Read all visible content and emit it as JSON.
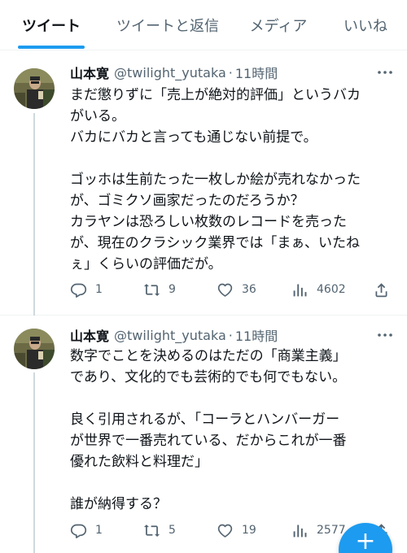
{
  "tabs": [
    {
      "label": "ツイート",
      "active": true
    },
    {
      "label": "ツイートと返信",
      "active": false
    },
    {
      "label": "メディア",
      "active": false
    },
    {
      "label": "いいね",
      "active": false
    }
  ],
  "colors": {
    "accent": "#1d9bf0",
    "text": "#0f1419",
    "secondary": "#536471",
    "divider": "#eff3f4"
  },
  "tweets": [
    {
      "name": "山本寛",
      "handle": "@twilight_yutaka",
      "dot": "·",
      "time": "11時間",
      "lines": [
        "まだ懲りずに「売上が絶対的評価」というバカ",
        "がいる。",
        "バカにバカと言っても通じない前提で。",
        "",
        "ゴッホは生前たった一枚しか絵が売れなかった",
        "が、ゴミクソ画家だったのだろうか？",
        "カラヤンは恐ろしい枚数のレコードを売った",
        "が、現在のクラシック業界では「まぁ、いたね",
        "ぇ」くらいの評価だが。"
      ],
      "replies": "1",
      "retweets": "9",
      "likes": "36",
      "views": "4602"
    },
    {
      "name": "山本寛",
      "handle": "@twilight_yutaka",
      "dot": "·",
      "time": "11時間",
      "lines": [
        "数字でことを決めるのはただの「商業主義」",
        "であり、文化的でも芸術的でも何でもない。",
        "",
        "良く引用されるが、「コーラとハンバーガー",
        "が世界で一番売れている、だからこれが一番",
        "優れた飲料と料理だ」",
        "",
        "誰が納得する？"
      ],
      "replies": "1",
      "retweets": "5",
      "likes": "19",
      "views": "2577"
    }
  ],
  "icons": {
    "reply": "reply-icon",
    "retweet": "retweet-icon",
    "like": "heart-icon",
    "views": "views-icon",
    "share": "share-icon",
    "more": "more-icon",
    "compose": "plus-icon"
  },
  "fab": {
    "label": "+"
  }
}
